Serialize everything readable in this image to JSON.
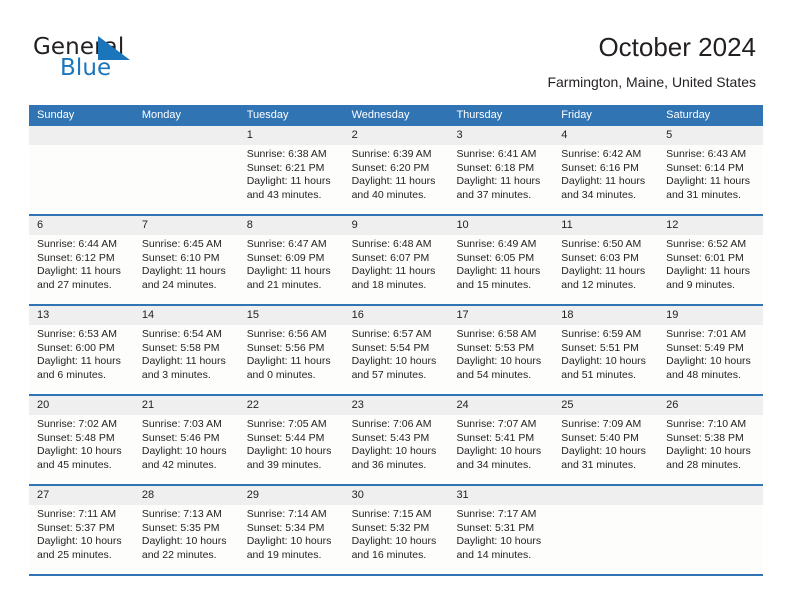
{
  "brand": {
    "name_top": "General",
    "name_bottom": "Blue",
    "sail_icon": "sail-triangle-icon",
    "color_dark": "#231f20",
    "color_blue": "#1b75bb"
  },
  "header": {
    "title": "October 2024",
    "subtitle": "Farmington, Maine, United States"
  },
  "theme": {
    "header_row_bg": "#3174b4",
    "day_number_bg": "#efefef",
    "cell_bg": "#fdfdfc",
    "separator": "#3174b4",
    "text": "#231f20"
  },
  "weekdays": [
    "Sunday",
    "Monday",
    "Tuesday",
    "Wednesday",
    "Thursday",
    "Friday",
    "Saturday"
  ],
  "weeks": [
    [
      {
        "date": "",
        "empty": true,
        "sunrise": "",
        "sunset": "",
        "daylight_line1": "",
        "daylight_line2": ""
      },
      {
        "date": "",
        "empty": true,
        "sunrise": "",
        "sunset": "",
        "daylight_line1": "",
        "daylight_line2": ""
      },
      {
        "date": "1",
        "empty": false,
        "sunrise": "Sunrise: 6:38 AM",
        "sunset": "Sunset: 6:21 PM",
        "daylight_line1": "Daylight: 11 hours",
        "daylight_line2": "and 43 minutes."
      },
      {
        "date": "2",
        "empty": false,
        "sunrise": "Sunrise: 6:39 AM",
        "sunset": "Sunset: 6:20 PM",
        "daylight_line1": "Daylight: 11 hours",
        "daylight_line2": "and 40 minutes."
      },
      {
        "date": "3",
        "empty": false,
        "sunrise": "Sunrise: 6:41 AM",
        "sunset": "Sunset: 6:18 PM",
        "daylight_line1": "Daylight: 11 hours",
        "daylight_line2": "and 37 minutes."
      },
      {
        "date": "4",
        "empty": false,
        "sunrise": "Sunrise: 6:42 AM",
        "sunset": "Sunset: 6:16 PM",
        "daylight_line1": "Daylight: 11 hours",
        "daylight_line2": "and 34 minutes."
      },
      {
        "date": "5",
        "empty": false,
        "sunrise": "Sunrise: 6:43 AM",
        "sunset": "Sunset: 6:14 PM",
        "daylight_line1": "Daylight: 11 hours",
        "daylight_line2": "and 31 minutes."
      }
    ],
    [
      {
        "date": "6",
        "empty": false,
        "sunrise": "Sunrise: 6:44 AM",
        "sunset": "Sunset: 6:12 PM",
        "daylight_line1": "Daylight: 11 hours",
        "daylight_line2": "and 27 minutes."
      },
      {
        "date": "7",
        "empty": false,
        "sunrise": "Sunrise: 6:45 AM",
        "sunset": "Sunset: 6:10 PM",
        "daylight_line1": "Daylight: 11 hours",
        "daylight_line2": "and 24 minutes."
      },
      {
        "date": "8",
        "empty": false,
        "sunrise": "Sunrise: 6:47 AM",
        "sunset": "Sunset: 6:09 PM",
        "daylight_line1": "Daylight: 11 hours",
        "daylight_line2": "and 21 minutes."
      },
      {
        "date": "9",
        "empty": false,
        "sunrise": "Sunrise: 6:48 AM",
        "sunset": "Sunset: 6:07 PM",
        "daylight_line1": "Daylight: 11 hours",
        "daylight_line2": "and 18 minutes."
      },
      {
        "date": "10",
        "empty": false,
        "sunrise": "Sunrise: 6:49 AM",
        "sunset": "Sunset: 6:05 PM",
        "daylight_line1": "Daylight: 11 hours",
        "daylight_line2": "and 15 minutes."
      },
      {
        "date": "11",
        "empty": false,
        "sunrise": "Sunrise: 6:50 AM",
        "sunset": "Sunset: 6:03 PM",
        "daylight_line1": "Daylight: 11 hours",
        "daylight_line2": "and 12 minutes."
      },
      {
        "date": "12",
        "empty": false,
        "sunrise": "Sunrise: 6:52 AM",
        "sunset": "Sunset: 6:01 PM",
        "daylight_line1": "Daylight: 11 hours",
        "daylight_line2": "and 9 minutes."
      }
    ],
    [
      {
        "date": "13",
        "empty": false,
        "sunrise": "Sunrise: 6:53 AM",
        "sunset": "Sunset: 6:00 PM",
        "daylight_line1": "Daylight: 11 hours",
        "daylight_line2": "and 6 minutes."
      },
      {
        "date": "14",
        "empty": false,
        "sunrise": "Sunrise: 6:54 AM",
        "sunset": "Sunset: 5:58 PM",
        "daylight_line1": "Daylight: 11 hours",
        "daylight_line2": "and 3 minutes."
      },
      {
        "date": "15",
        "empty": false,
        "sunrise": "Sunrise: 6:56 AM",
        "sunset": "Sunset: 5:56 PM",
        "daylight_line1": "Daylight: 11 hours",
        "daylight_line2": "and 0 minutes."
      },
      {
        "date": "16",
        "empty": false,
        "sunrise": "Sunrise: 6:57 AM",
        "sunset": "Sunset: 5:54 PM",
        "daylight_line1": "Daylight: 10 hours",
        "daylight_line2": "and 57 minutes."
      },
      {
        "date": "17",
        "empty": false,
        "sunrise": "Sunrise: 6:58 AM",
        "sunset": "Sunset: 5:53 PM",
        "daylight_line1": "Daylight: 10 hours",
        "daylight_line2": "and 54 minutes."
      },
      {
        "date": "18",
        "empty": false,
        "sunrise": "Sunrise: 6:59 AM",
        "sunset": "Sunset: 5:51 PM",
        "daylight_line1": "Daylight: 10 hours",
        "daylight_line2": "and 51 minutes."
      },
      {
        "date": "19",
        "empty": false,
        "sunrise": "Sunrise: 7:01 AM",
        "sunset": "Sunset: 5:49 PM",
        "daylight_line1": "Daylight: 10 hours",
        "daylight_line2": "and 48 minutes."
      }
    ],
    [
      {
        "date": "20",
        "empty": false,
        "sunrise": "Sunrise: 7:02 AM",
        "sunset": "Sunset: 5:48 PM",
        "daylight_line1": "Daylight: 10 hours",
        "daylight_line2": "and 45 minutes."
      },
      {
        "date": "21",
        "empty": false,
        "sunrise": "Sunrise: 7:03 AM",
        "sunset": "Sunset: 5:46 PM",
        "daylight_line1": "Daylight: 10 hours",
        "daylight_line2": "and 42 minutes."
      },
      {
        "date": "22",
        "empty": false,
        "sunrise": "Sunrise: 7:05 AM",
        "sunset": "Sunset: 5:44 PM",
        "daylight_line1": "Daylight: 10 hours",
        "daylight_line2": "and 39 minutes."
      },
      {
        "date": "23",
        "empty": false,
        "sunrise": "Sunrise: 7:06 AM",
        "sunset": "Sunset: 5:43 PM",
        "daylight_line1": "Daylight: 10 hours",
        "daylight_line2": "and 36 minutes."
      },
      {
        "date": "24",
        "empty": false,
        "sunrise": "Sunrise: 7:07 AM",
        "sunset": "Sunset: 5:41 PM",
        "daylight_line1": "Daylight: 10 hours",
        "daylight_line2": "and 34 minutes."
      },
      {
        "date": "25",
        "empty": false,
        "sunrise": "Sunrise: 7:09 AM",
        "sunset": "Sunset: 5:40 PM",
        "daylight_line1": "Daylight: 10 hours",
        "daylight_line2": "and 31 minutes."
      },
      {
        "date": "26",
        "empty": false,
        "sunrise": "Sunrise: 7:10 AM",
        "sunset": "Sunset: 5:38 PM",
        "daylight_line1": "Daylight: 10 hours",
        "daylight_line2": "and 28 minutes."
      }
    ],
    [
      {
        "date": "27",
        "empty": false,
        "sunrise": "Sunrise: 7:11 AM",
        "sunset": "Sunset: 5:37 PM",
        "daylight_line1": "Daylight: 10 hours",
        "daylight_line2": "and 25 minutes."
      },
      {
        "date": "28",
        "empty": false,
        "sunrise": "Sunrise: 7:13 AM",
        "sunset": "Sunset: 5:35 PM",
        "daylight_line1": "Daylight: 10 hours",
        "daylight_line2": "and 22 minutes."
      },
      {
        "date": "29",
        "empty": false,
        "sunrise": "Sunrise: 7:14 AM",
        "sunset": "Sunset: 5:34 PM",
        "daylight_line1": "Daylight: 10 hours",
        "daylight_line2": "and 19 minutes."
      },
      {
        "date": "30",
        "empty": false,
        "sunrise": "Sunrise: 7:15 AM",
        "sunset": "Sunset: 5:32 PM",
        "daylight_line1": "Daylight: 10 hours",
        "daylight_line2": "and 16 minutes."
      },
      {
        "date": "31",
        "empty": false,
        "sunrise": "Sunrise: 7:17 AM",
        "sunset": "Sunset: 5:31 PM",
        "daylight_line1": "Daylight: 10 hours",
        "daylight_line2": "and 14 minutes."
      },
      {
        "date": "",
        "empty": true,
        "sunrise": "",
        "sunset": "",
        "daylight_line1": "",
        "daylight_line2": ""
      },
      {
        "date": "",
        "empty": true,
        "sunrise": "",
        "sunset": "",
        "daylight_line1": "",
        "daylight_line2": ""
      }
    ]
  ]
}
